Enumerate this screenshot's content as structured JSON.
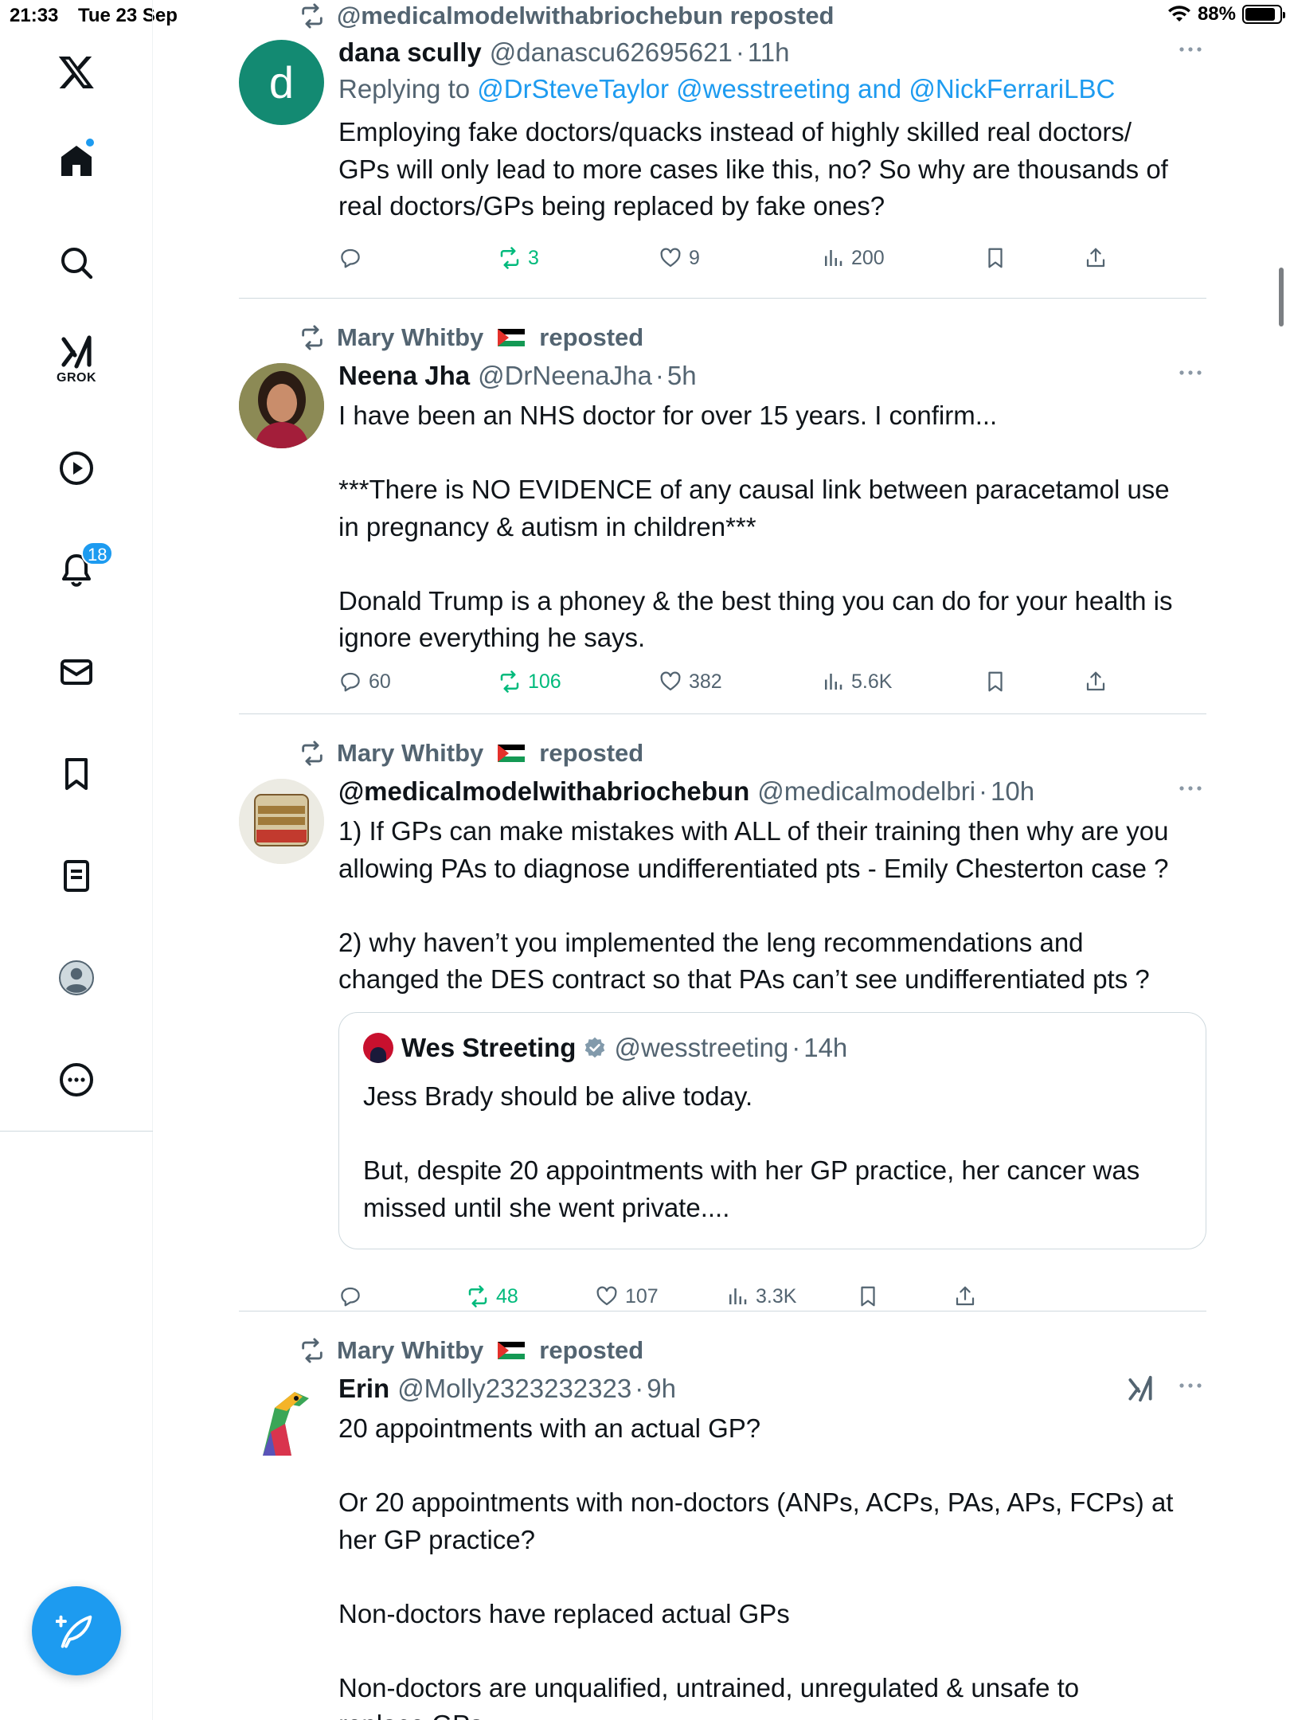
{
  "status_bar": {
    "time": "21:33",
    "date": "Tue 23 Sep",
    "battery": "88%",
    "battery_level": 0.88
  },
  "sidebar": {
    "items": [
      {
        "icon": "x-logo-icon"
      },
      {
        "icon": "home-icon",
        "has_dot": true
      },
      {
        "icon": "search-icon"
      },
      {
        "icon": "grok-icon",
        "label": "GROK"
      },
      {
        "icon": "video-icon"
      },
      {
        "icon": "bell-icon",
        "badge": "18"
      },
      {
        "icon": "mail-icon"
      },
      {
        "icon": "bookmark-icon"
      },
      {
        "icon": "article-icon"
      },
      {
        "icon": "profile-icon"
      },
      {
        "icon": "more-circle-icon"
      }
    ],
    "compose_icon": "compose-feather-icon"
  },
  "colors": {
    "accent": "#1d9bf0",
    "repost_green": "#00ba7c",
    "muted": "#536471"
  },
  "tweets": [
    {
      "repost_by": "@medicalmodelwithabriochebun reposted",
      "name": "dana scully",
      "handle": "@danascu62695621",
      "time": "11h",
      "avatar_letter": "d",
      "reply_prefix": "Replying to ",
      "reply_users": "@DrSteveTaylor @wesstreeting and @NickFerrariLBC",
      "text": "Employing fake doctors/quacks instead of highly skilled real doctors/\nGPs will only lead to more cases like this, no? So why are thousands of\nreal doctors/GPs being replaced by fake ones?",
      "replies": "",
      "reposts": "3",
      "likes": "9",
      "views": "200"
    },
    {
      "repost_by_name": "Mary Whitby",
      "repost_suffix": "reposted",
      "name": "Neena Jha",
      "handle": "@DrNeenaJha",
      "time": "5h",
      "text": "I have been an NHS doctor for over 15 years. I confirm...\n\n***There is NO EVIDENCE of any causal link between paracetamol use\nin pregnancy & autism in children***\n\nDonald Trump is a phoney & the best thing you can do for your health is\nignore everything he says.",
      "replies": "60",
      "reposts": "106",
      "likes": "382",
      "views": "5.6K"
    },
    {
      "repost_by_name": "Mary Whitby",
      "repost_suffix": "reposted",
      "name": "@medicalmodelwithabriochebun",
      "handle": "@medicalmodelbri",
      "time": "10h",
      "text": "1) If GPs can make mistakes with ALL of their training then why are you\nallowing PAs to diagnose undifferentiated pts - Emily Chesterton case ?\n\n2) why haven’t you implemented the leng recommendations and\nchanged the DES contract so that PAs can’t see undifferentiated pts ?",
      "quote": {
        "name": "Wes Streeting",
        "handle": "@wesstreeting",
        "time": "14h",
        "text": "Jess Brady should be alive today.\n\nBut, despite 20 appointments with her GP practice, her cancer was\nmissed until she went private...."
      },
      "replies": "",
      "reposts": "48",
      "likes": "107",
      "views": "3.3K"
    },
    {
      "repost_by_name": "Mary Whitby",
      "repost_suffix": "reposted",
      "name": "Erin",
      "handle": "@Molly2323232323",
      "time": "9h",
      "text": "20 appointments with an actual GP?\n\nOr 20 appointments with non-doctors (ANPs, ACPs, PAs, APs, FCPs) at\nher GP practice?\n\nNon-doctors have replaced actual GPs\n\nNon-doctors are unqualified, untrained, unregulated & unsafe to\nreplace GPs"
    }
  ],
  "separators": {
    "dot": "·"
  }
}
